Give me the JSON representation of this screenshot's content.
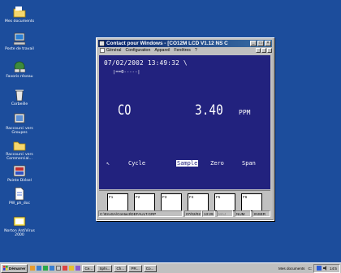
{
  "desktop": {
    "icons": [
      {
        "label": "Mes documents"
      },
      {
        "label": "Poste de travail"
      },
      {
        "label": "Favoris réseau"
      },
      {
        "label": "Corbeille"
      },
      {
        "label": "Raccourci vers Groupes"
      },
      {
        "label": "Raccourci vers Commercial..."
      },
      {
        "label": "Pointe Diésel"
      },
      {
        "label": "PW_ph_doc"
      },
      {
        "label": "Norton AntiVirus 2000"
      }
    ]
  },
  "window": {
    "title": "Contact pour Windows - [CO12M LCD  V1.12 NS  C",
    "menu": [
      "Général",
      "Configuration",
      "Appareil",
      "Fenêtres",
      "?"
    ]
  },
  "display": {
    "datetime": "07/02/2002  13:49:32  \\",
    "bargraph": "|==0-----|",
    "gas": "CO",
    "value": "3.40",
    "unit": "PPM",
    "cursor": "↖",
    "softkeys": [
      "Cycle",
      "Sample",
      "Zero",
      "Span"
    ],
    "selected_softkey": "Sample"
  },
  "function_keys": [
    "F1",
    "F2",
    "F3",
    "F4",
    "F5",
    "F6"
  ],
  "statusbar": {
    "path": "C:\\EnvSA\\Contact\\DEFAULT.GRP",
    "date": "07/02/02",
    "time": "13:29",
    "maj": "MAJ",
    "num": "NUM",
    "inser": "INSER"
  },
  "taskbar": {
    "start_label": "Démarrer",
    "tasks": [
      "Ce...",
      "Sphi...",
      "Ch...",
      "PR...",
      "Co..."
    ],
    "address_label": "Mes documents",
    "address_drive": "C:",
    "tray_time": "14:5"
  },
  "colors": {
    "desktop": "#1c4d9c",
    "screen_bg": "#22227e",
    "titlebar": "#0a246a",
    "panel": "#c0c0c0"
  }
}
